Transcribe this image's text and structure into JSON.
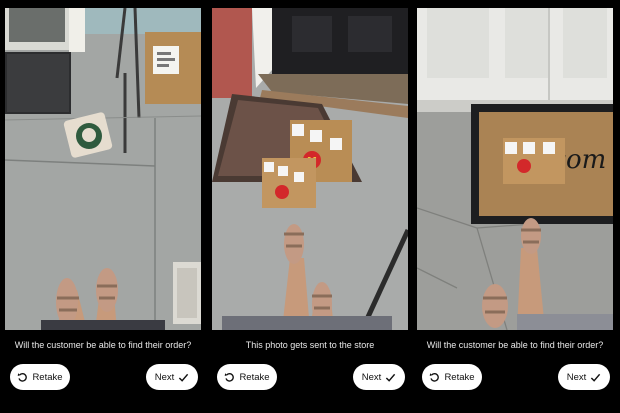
{
  "screens": [
    {
      "caption": "Will the customer be able to find their order?",
      "retake_label": "Retake",
      "next_label": "Next",
      "retake_icon": "rotate-ccw-icon",
      "next_icon": "checkmark-icon"
    },
    {
      "caption": "This photo gets sent to the store",
      "retake_label": "Retake",
      "next_label": "Next",
      "retake_icon": "rotate-ccw-icon",
      "next_icon": "checkmark-icon"
    },
    {
      "caption": "Will the customer be able to find their order?",
      "retake_label": "Retake",
      "next_label": "Next",
      "retake_icon": "rotate-ccw-icon",
      "next_icon": "checkmark-icon"
    }
  ],
  "doormat_lettering": "elcom"
}
